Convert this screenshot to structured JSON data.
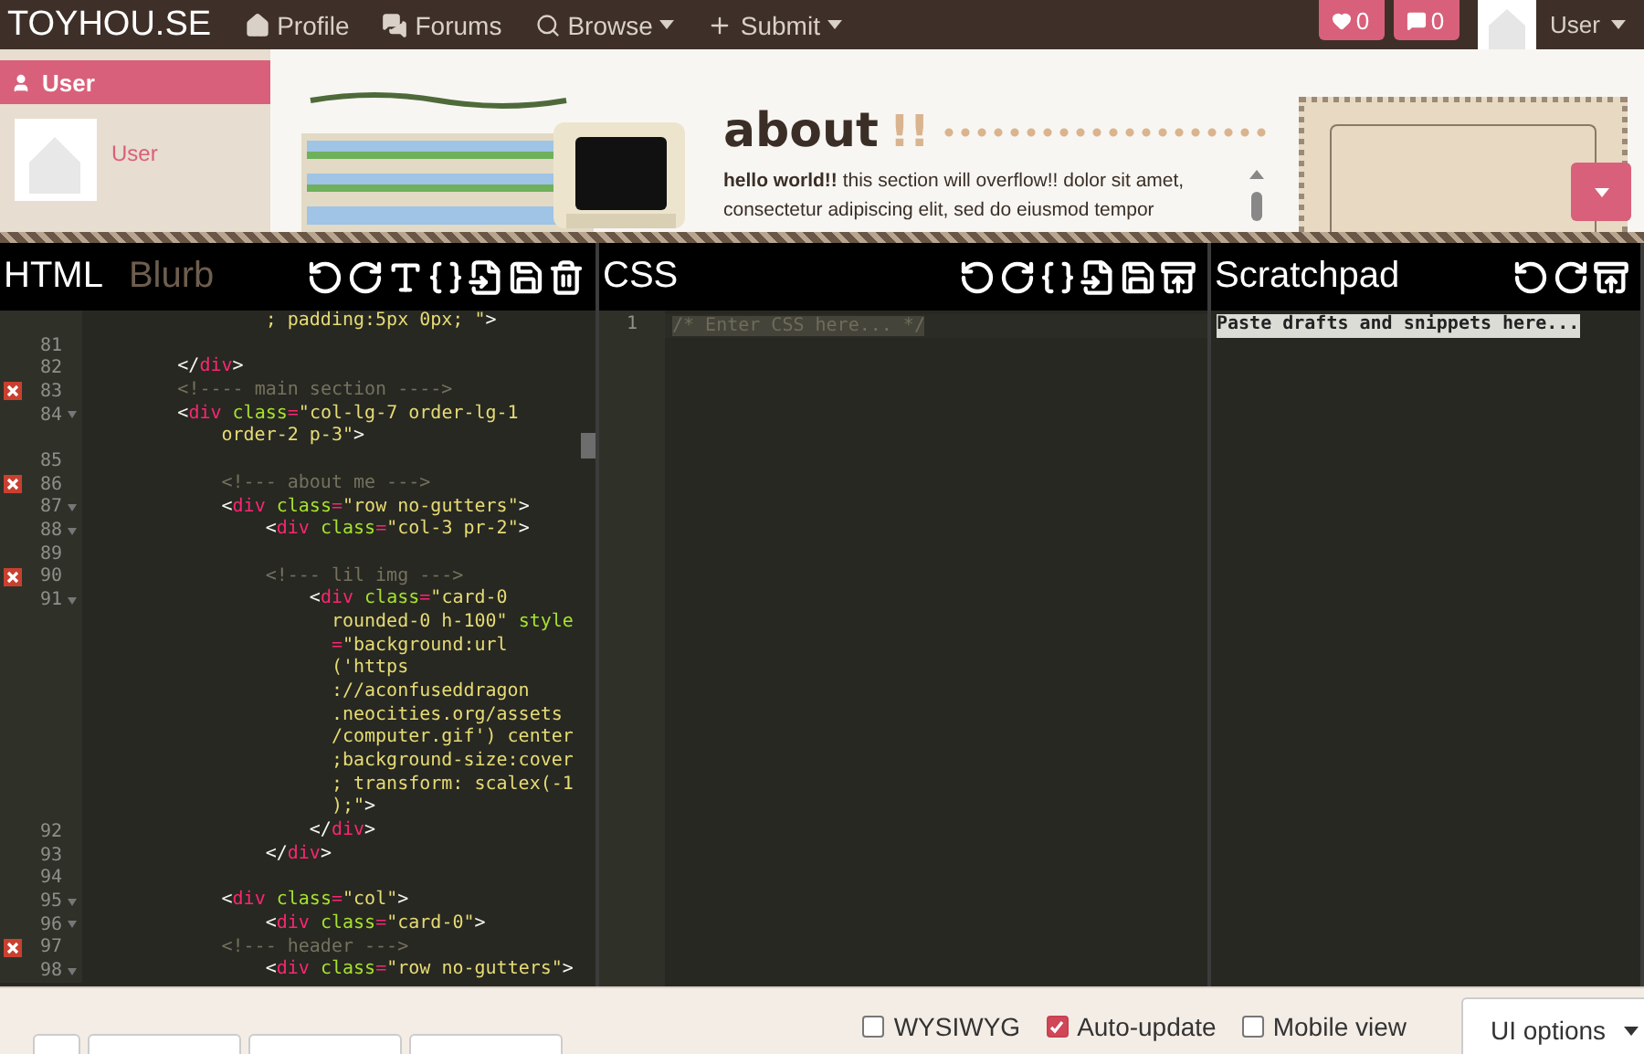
{
  "navbar": {
    "brand": "TOYHOU.SE",
    "links": [
      {
        "label": "Profile",
        "dropdown": false
      },
      {
        "label": "Forums",
        "dropdown": false
      },
      {
        "label": "Browse",
        "dropdown": true
      },
      {
        "label": "Submit",
        "dropdown": true
      }
    ],
    "counters": [
      "0",
      "0"
    ],
    "user": "User"
  },
  "preview": {
    "sidebar": {
      "header": "User",
      "username": "User"
    },
    "about": {
      "heading": "about",
      "marks": "!!",
      "lines": [
        "**hello world!!** this section will overflow!! dolor sit amet,",
        "consectetur adipiscing elit, sed do eiusmod tempor"
      ]
    }
  },
  "editors": [
    {
      "kind": "code",
      "tabs": [
        {
          "label": "HTML",
          "selected": true
        },
        {
          "label": "Blurb",
          "selected": false
        }
      ],
      "rows": [
        {
          "code": "                ; padding:5px 0px; \">"
        },
        {
          "number": "81",
          "error": false,
          "fold": false
        },
        {
          "number": "82",
          "error": false,
          "fold": false,
          "code": "        </div>"
        },
        {
          "number": "83",
          "error": true,
          "fold": false,
          "code": "        <!---- main section ---->"
        },
        {
          "number": "84",
          "error": false,
          "fold": true,
          "code": "        <div class=\"col-lg-7 order-lg-1"
        },
        {
          "code": "            order-2 p-3\">"
        },
        {
          "number": "85",
          "error": false,
          "fold": false
        },
        {
          "number": "86",
          "error": true,
          "fold": false,
          "code": "            <!--- about me --->"
        },
        {
          "number": "87",
          "error": false,
          "fold": true,
          "code": "            <div class=\"row no-gutters\">"
        },
        {
          "number": "88",
          "error": false,
          "fold": true,
          "code": "                <div class=\"col-3 pr-2\">"
        },
        {
          "number": "89",
          "error": false,
          "fold": false
        },
        {
          "number": "90",
          "error": true,
          "fold": false,
          "code": "                <!--- lil img --->"
        },
        {
          "number": "91",
          "error": false,
          "fold": true,
          "code": "                    <div class=\"card-0"
        },
        {
          "code": "                      rounded-0 h-100\" style"
        },
        {
          "code": "                      =\"background:url"
        },
        {
          "code": "                      ('https"
        },
        {
          "code": "                      ://aconfuseddragon"
        },
        {
          "code": "                      .neocities.org/assets"
        },
        {
          "code": "                      /computer.gif') center"
        },
        {
          "code": "                      ;background-size:cover"
        },
        {
          "code": "                      ; transform: scalex(-1"
        },
        {
          "code": "                      );\">"
        },
        {
          "number": "92",
          "error": false,
          "fold": false,
          "code": "                    </div>"
        },
        {
          "number": "93",
          "error": false,
          "fold": false,
          "code": "                </div>"
        },
        {
          "number": "94",
          "error": false,
          "fold": false
        },
        {
          "number": "95",
          "error": false,
          "fold": true,
          "code": "            <div class=\"col\">"
        },
        {
          "number": "96",
          "error": false,
          "fold": true,
          "code": "                <div class=\"card-0\">"
        },
        {
          "number": "97",
          "error": true,
          "fold": false,
          "code": "            <!--- header --->"
        },
        {
          "number": "98",
          "error": false,
          "fold": true,
          "code": "                <div class=\"row no-gutters\">"
        }
      ]
    },
    {
      "kind": "css",
      "tabs": [
        {
          "label": "CSS",
          "selected": true
        }
      ],
      "line_number": "1",
      "placeholder": "/* Enter CSS here... */"
    },
    {
      "kind": "scratch",
      "tabs": [
        {
          "label": "Scratchpad",
          "selected": true
        }
      ],
      "placeholder": "Paste drafts and snippets here..."
    }
  ],
  "footer": {
    "options": [
      {
        "label": "WYSIWYG",
        "checked": false
      },
      {
        "label": "Auto-update",
        "checked": true
      },
      {
        "label": "Mobile view",
        "checked": false
      }
    ],
    "menu_button": "UI options"
  }
}
